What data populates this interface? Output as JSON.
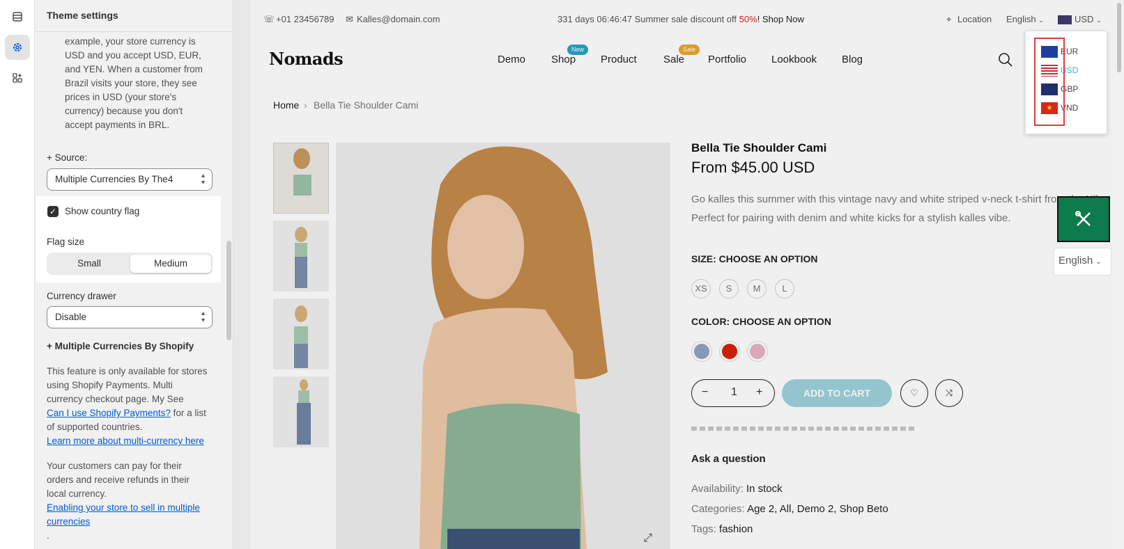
{
  "panel": {
    "title": "Theme settings",
    "intro_lines": [
      "example, your store currency is",
      "USD and you accept USD, EUR,",
      "and YEN. When a customer from",
      "Brazil visits your store, they see",
      "prices in USD (your store's",
      "currency) because you don't",
      "accept payments in BRL."
    ],
    "source_label": "+ Source:",
    "source_value": "Multiple Currencies By The4",
    "show_flag_label": "Show country flag",
    "flag_size_label": "Flag size",
    "flag_size_options": [
      "Small",
      "Medium"
    ],
    "flag_size_selected": "Medium",
    "drawer_label": "Currency drawer",
    "drawer_value": "Disable",
    "shopify_heading": "+ Multiple Currencies By Shopify",
    "shopify_text_1": [
      "This feature is only available for stores",
      "using Shopify Payments. Multi",
      "currency checkout page. My See"
    ],
    "shopify_link_1": "Can I use Shopify Payments?",
    "shopify_text_1b": " for a list",
    "shopify_text_1c": "of supported countries.",
    "shopify_link_2": "Learn more about multi-currency here",
    "shopify_text_2": [
      "Your customers can pay for their",
      "orders and receive refunds in their",
      "local currency."
    ],
    "shopify_link_3a": "Enabling your store to sell in multiple",
    "shopify_link_3b": "currencies",
    "dot": "."
  },
  "store": {
    "phone": "+01 23456789",
    "email": "Kalles@domain.com",
    "promo_text": "331 days 06:46:47 Summer sale discount off ",
    "promo_pct": "50%",
    "promo_shop": "! Shop Now",
    "location": "Location",
    "language": "English",
    "currency": "USD",
    "logo": "Nomads",
    "nav": [
      "Demo",
      "Shop",
      "Product",
      "Sale",
      "Portfolio",
      "Lookbook",
      "Blog"
    ],
    "badge_new": "New",
    "badge_sale": "Sale",
    "breadcrumb_home": "Home",
    "breadcrumb_current": "Bella Tie Shoulder Cami",
    "product_title": "Bella Tie Shoulder Cami",
    "product_price": "From $45.00 USD",
    "product_desc": "Go kalles this summer with this vintage navy and white striped v-neck t-shirt from the Nike. Perfect for pairing with denim and white kicks for a stylish kalles vibe.",
    "size_heading": "SIZE: CHOOSE AN OPTION",
    "sizes": [
      "XS",
      "S",
      "M",
      "L"
    ],
    "color_heading": "COLOR: CHOOSE AN OPTION",
    "qty": "1",
    "add_to_cart": "ADD TO CART",
    "ask": "Ask a question",
    "availability_k": "Availability:",
    "availability_v": "In stock",
    "categories_k": "Categories:",
    "categories_v": "Age 2, All, Demo 2, Shop Beto",
    "tags_k": "Tags:",
    "tags_v": "fashion",
    "lang_box": "English"
  },
  "currency_popup": [
    "EUR",
    "USD",
    "GBP",
    "VND"
  ],
  "colors": {
    "accent_link": "#005bd3",
    "sale_red": "#e4211c",
    "add_to_cart": "#9ed2dc",
    "tool_green": "#0d7b4c",
    "swatch_blue": "#8fa3c3",
    "swatch_red": "#d6230b",
    "swatch_pink": "#e9b3c4",
    "usd_active": "#35b3d1"
  }
}
